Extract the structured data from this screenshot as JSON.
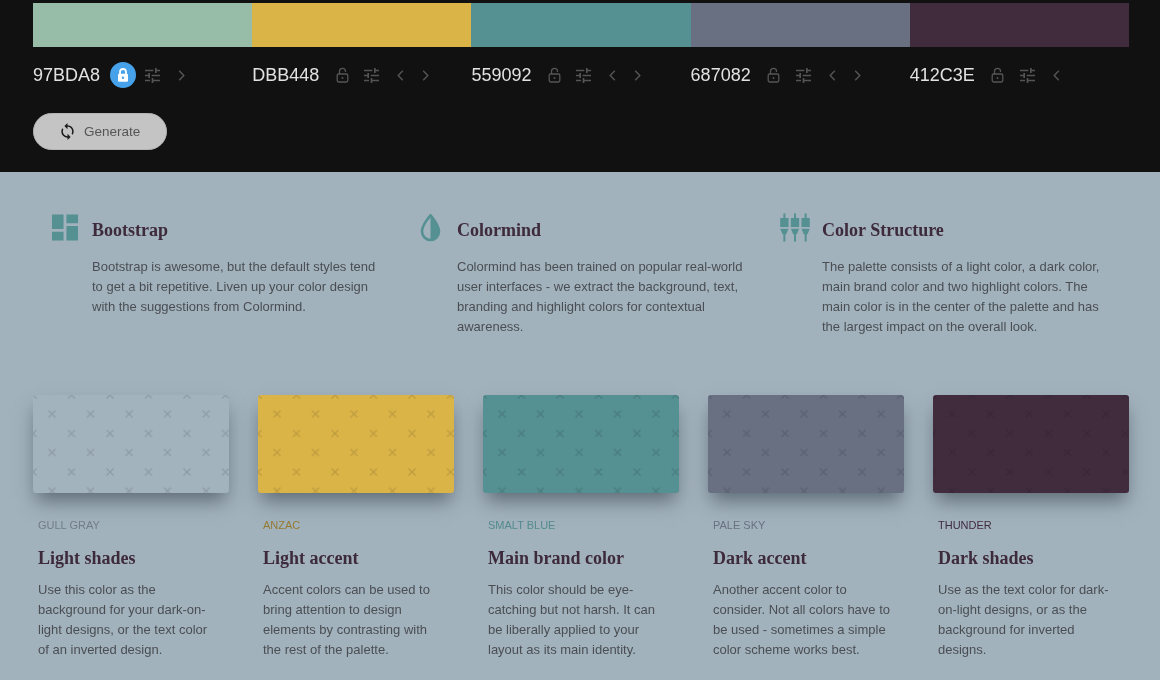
{
  "palette": [
    {
      "hex": "97BDA8",
      "color": "#97bda8",
      "locked": true,
      "can_move_left": false,
      "can_move_right": true
    },
    {
      "hex": "DBB448",
      "color": "#dbb448",
      "locked": false,
      "can_move_left": true,
      "can_move_right": true
    },
    {
      "hex": "559092",
      "color": "#559092",
      "locked": false,
      "can_move_left": true,
      "can_move_right": true
    },
    {
      "hex": "687082",
      "color": "#687082",
      "locked": false,
      "can_move_left": true,
      "can_move_right": true
    },
    {
      "hex": "412C3E",
      "color": "#412c3e",
      "locked": false,
      "can_move_left": true,
      "can_move_right": false
    }
  ],
  "generate_button": {
    "label": "Generate"
  },
  "features": [
    {
      "kind": "grid",
      "title": "Bootstrap",
      "text": "Bootstrap is awesome, but the default styles tend to get a bit repetitive. Liven up your color design with the suggestions from Colormind."
    },
    {
      "kind": "drop",
      "title": "Colormind",
      "text": "Colormind has been trained on popular real-world user interfaces - we extract the background, text, branding and highlight colors for contextual awareness."
    },
    {
      "kind": "connectors",
      "title": "Color Structure",
      "text": "The palette consists of a light color, a dark color, main brand color and two highlight colors. The main color is in the center of the palette and has the largest impact on the overall look."
    }
  ],
  "cards": [
    {
      "name": "GULL GRAY",
      "color": "#a3b3be",
      "title": "Light shades",
      "text": "Use this color as the background for your dark-on-light designs, or the text color of an inverted design."
    },
    {
      "name": "ANZAC",
      "color": "#dbb448",
      "title": "Light accent",
      "text": "Accent colors can be used to bring attention to design elements by contrasting with the rest of the palette."
    },
    {
      "name": "SMALT BLUE",
      "color": "#559092",
      "title": "Main brand color",
      "text": "This color should be eye-catching but not harsh. It can be liberally applied to your layout as its main identity."
    },
    {
      "name": "PALE SKY",
      "color": "#687082",
      "title": "Dark accent",
      "text": "Another accent color to consider. Not all colors have to be used - sometimes a simple color scheme works best."
    },
    {
      "name": "THUNDER",
      "color": "#412c3e",
      "title": "Dark shades",
      "text": "Use as the text color for dark-on-light designs, or as the background for inverted designs."
    }
  ]
}
